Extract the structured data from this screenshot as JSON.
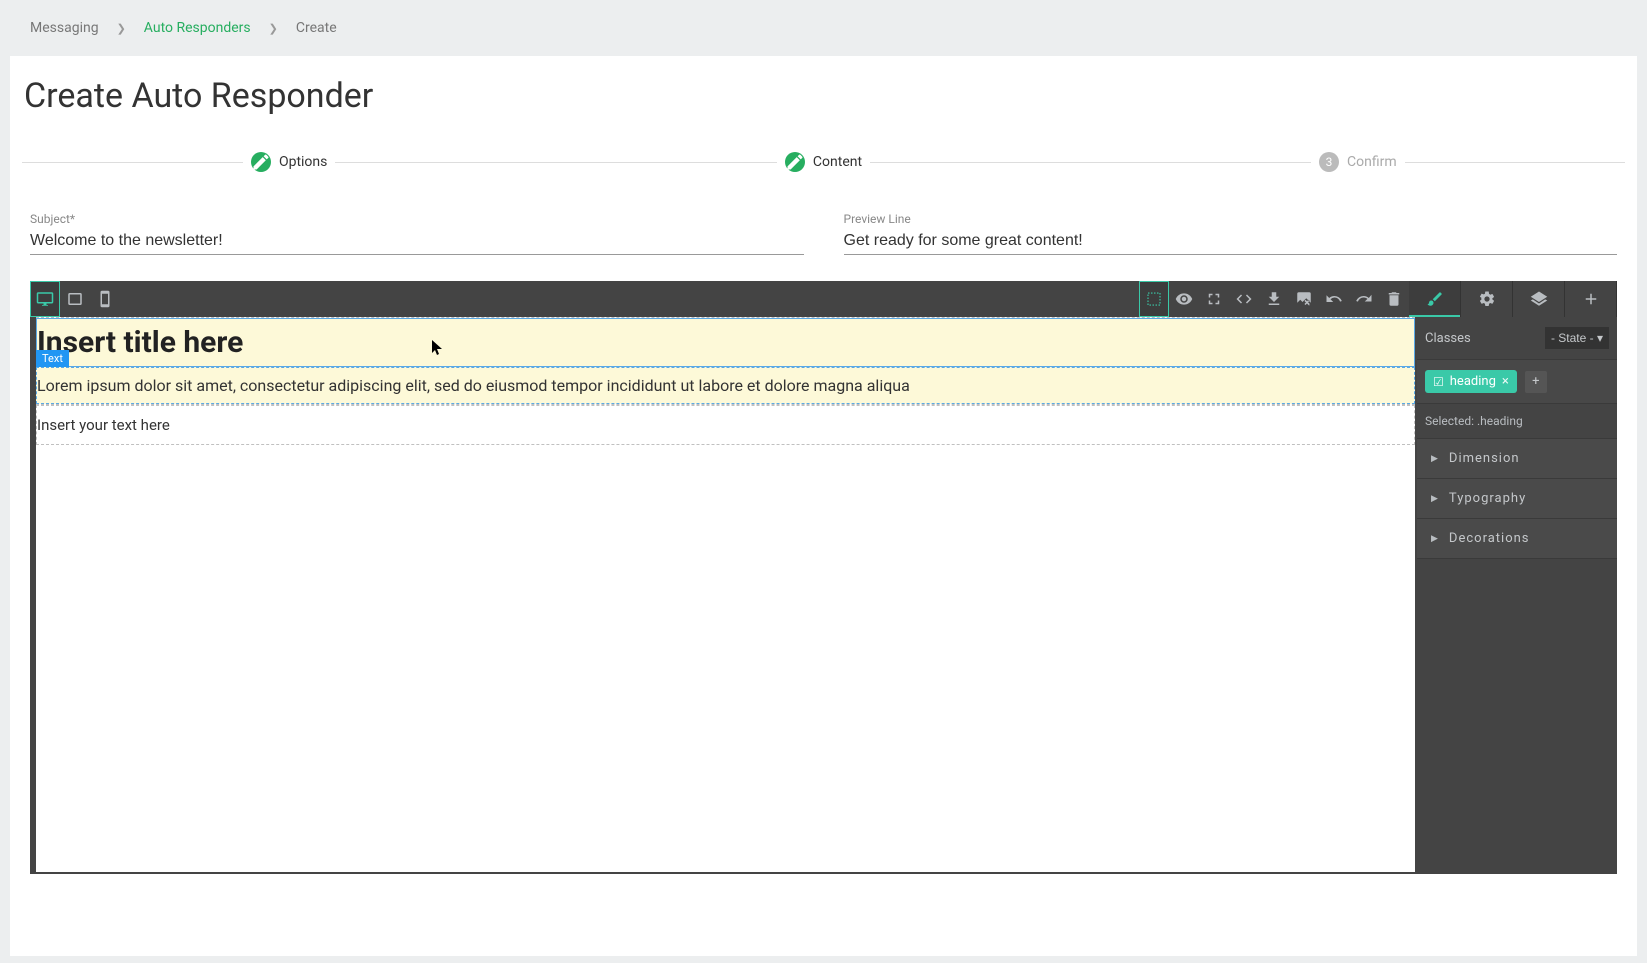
{
  "breadcrumb": {
    "items": [
      {
        "label": "Messaging"
      },
      {
        "label": "Auto Responders"
      },
      {
        "label": "Create"
      }
    ]
  },
  "page": {
    "title": "Create Auto Responder"
  },
  "wizard": {
    "steps": [
      {
        "label": "Options",
        "num": "✎"
      },
      {
        "label": "Content",
        "num": "✎"
      },
      {
        "label": "Confirm",
        "num": "3"
      }
    ]
  },
  "form": {
    "subject_label": "Subject*",
    "subject_value": "Welcome to the newsletter!",
    "preview_label": "Preview Line",
    "preview_value": "Get ready for some great content!"
  },
  "editor": {
    "hover_badge": "Text",
    "title_text": "Insert title here",
    "lorem_text": "Lorem ipsum dolor sit amet, consectetur adipiscing elit, sed do eiusmod tempor incididunt ut labore et dolore magna aliqua",
    "placeholder_text": "Insert your text here"
  },
  "sidebar": {
    "classes_label": "Classes",
    "state_label": "- State -",
    "tag": "heading",
    "close_glyph": "×",
    "add_glyph": "+",
    "selected_prefix": "Selected:",
    "selected_value": ".heading",
    "accordion": [
      {
        "label": "Dimension"
      },
      {
        "label": "Typography"
      },
      {
        "label": "Decorations"
      }
    ]
  }
}
